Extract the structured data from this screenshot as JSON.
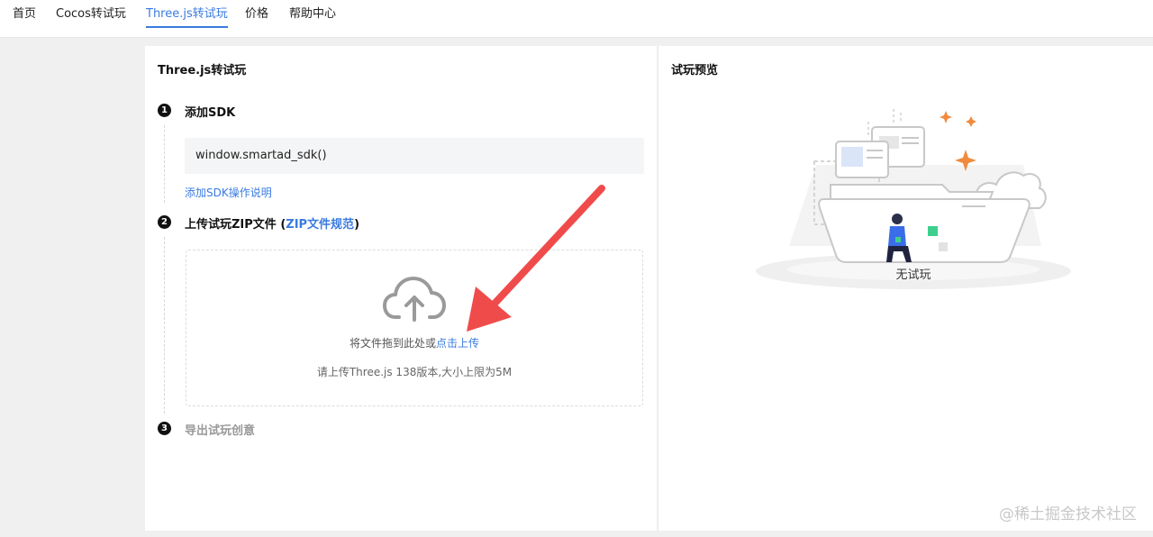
{
  "nav": {
    "tabs": [
      {
        "label": "首页"
      },
      {
        "label": "Cocos转试玩"
      },
      {
        "label": "Three.js转试玩"
      },
      {
        "label": "价格"
      },
      {
        "label": "帮助中心"
      }
    ],
    "active_tab": "Three.js转试玩"
  },
  "left_panel": {
    "title": "Three.js转试玩",
    "step1": {
      "number": "1",
      "label": "添加SDK",
      "code": "window.smartad_sdk()",
      "help_link": "添加SDK操作说明"
    },
    "step2": {
      "number": "2",
      "label": "上传试玩ZIP文件 (",
      "link": "ZIP文件规范",
      "label_end": ")"
    },
    "upload": {
      "icon": "cloud-upload-icon",
      "prompt": "将文件拖到此处或",
      "prompt_link": "点击上传",
      "hint": "请上传Three.js 138版本,大小上限为5M"
    },
    "step3": {
      "number": "3",
      "label": "导出试玩创意"
    }
  },
  "right_panel": {
    "title": "试玩预览",
    "empty_text": "无试玩",
    "illustration": "empty-folder-illustration"
  },
  "watermark": "@稀土掘金技术社区",
  "colors": {
    "accent": "#3a7be0",
    "arrow": "#f04b4b"
  }
}
